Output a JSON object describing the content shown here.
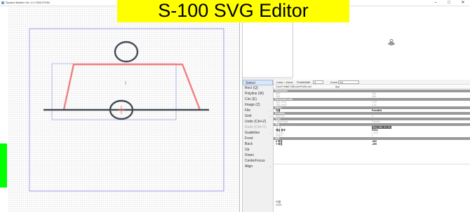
{
  "titlebar": {
    "title": "Symbol Builder Ver 1.0.7268.27954",
    "minimize": "–",
    "maximize": "□",
    "close": "✕"
  },
  "banner": {
    "text": "S-100 SVG Editor"
  },
  "list": {
    "items": [
      "Bl",
      "Bl",
      "PointSet",
      "PointSet",
      "PointSet"
    ]
  },
  "sidebar": {
    "items": [
      {
        "label": "Select",
        "state": "selected",
        "chev": ""
      },
      {
        "label": "Rect (Q)",
        "state": "",
        "chev": ""
      },
      {
        "label": "Polyline (W)",
        "state": "",
        "chev": ""
      },
      {
        "label": "Circ (E)",
        "state": "",
        "chev": ""
      },
      {
        "label": "Image (Z)",
        "state": "",
        "chev": ""
      },
      {
        "label": "File",
        "state": "",
        "chev": "→"
      },
      {
        "label": "Grid",
        "state": "",
        "chev": "→"
      },
      {
        "label": "Undo (Ctrl+Z)",
        "state": "",
        "chev": ""
      },
      {
        "label": "Redo (Ctrl+Y)",
        "state": "disabled",
        "chev": ""
      },
      {
        "label": "Guideline",
        "state": "",
        "chev": "→"
      },
      {
        "label": "Front",
        "state": "",
        "chev": ""
      },
      {
        "label": "Back",
        "state": "",
        "chev": ""
      },
      {
        "label": "Up",
        "state": "",
        "chev": ""
      },
      {
        "label": "Down",
        "state": "",
        "chev": ""
      },
      {
        "label": "CenterFocus",
        "state": "",
        "chev": ""
      },
      {
        "label": "Align",
        "state": "",
        "chev": "→"
      }
    ]
  },
  "toolbar": {
    "color_label": "Color = None",
    "pointwidth_label": "PointWidth",
    "pointwidth_value": "3",
    "zoom_label": "Zoom",
    "zoom_value": "0.6"
  },
  "filebar": {
    "label": "ColorProfile",
    "path": "C:\\SB\\colorProfile.xml",
    "app": "App"
  },
  "props": {
    "rows": [
      {
        "type": "header",
        "k": "Dimension",
        "v": ""
      },
      {
        "type": "row",
        "k": "높이",
        "v": "150"
      },
      {
        "type": "row",
        "k": "너비",
        "v": "285"
      },
      {
        "type": "header",
        "k": "Dimension mm",
        "v": ""
      },
      {
        "type": "row",
        "k": "높이 (mm)",
        "v": "1.53"
      },
      {
        "type": "row",
        "k": "너비 (mm)",
        "v": "2.91"
      },
      {
        "type": "header",
        "k": "Name",
        "v": ""
      },
      {
        "type": "strong",
        "k": "이름",
        "v": "PointSet"
      },
      {
        "type": "header",
        "k": "Rotation",
        "v": ""
      },
      {
        "type": "row",
        "k": "회전각도",
        "v": "0"
      },
      {
        "type": "header",
        "k": "Type",
        "v": ""
      },
      {
        "type": "row",
        "k": "ObjectType",
        "v": "Polyline"
      },
      {
        "type": "header",
        "k": "색상",
        "v": ""
      },
      {
        "type": "dark",
        "k": "선 색",
        "v": "Red, 255, 91, 91"
      },
      {
        "type": "strong",
        "k": "채움 유무",
        "v": "False"
      },
      {
        "type": "row",
        "k": "선 두께",
        "v": "1.000"
      },
      {
        "type": "row",
        "k": "투명도",
        "v": "0"
      },
      {
        "type": "header",
        "k": "위치",
        "v": ""
      },
      {
        "type": "strong",
        "k": "X 좌표",
        "v": "-362"
      },
      {
        "type": "strong",
        "k": "Y 좌표",
        "v": "-495"
      }
    ]
  },
  "bottom": {
    "title": "이름",
    "desc": "name"
  },
  "colors": {
    "shape_stroke": "#444b55",
    "trapezoid": "#f08080",
    "guide": "#8a8ae6",
    "crosshair": "#ff6060"
  }
}
